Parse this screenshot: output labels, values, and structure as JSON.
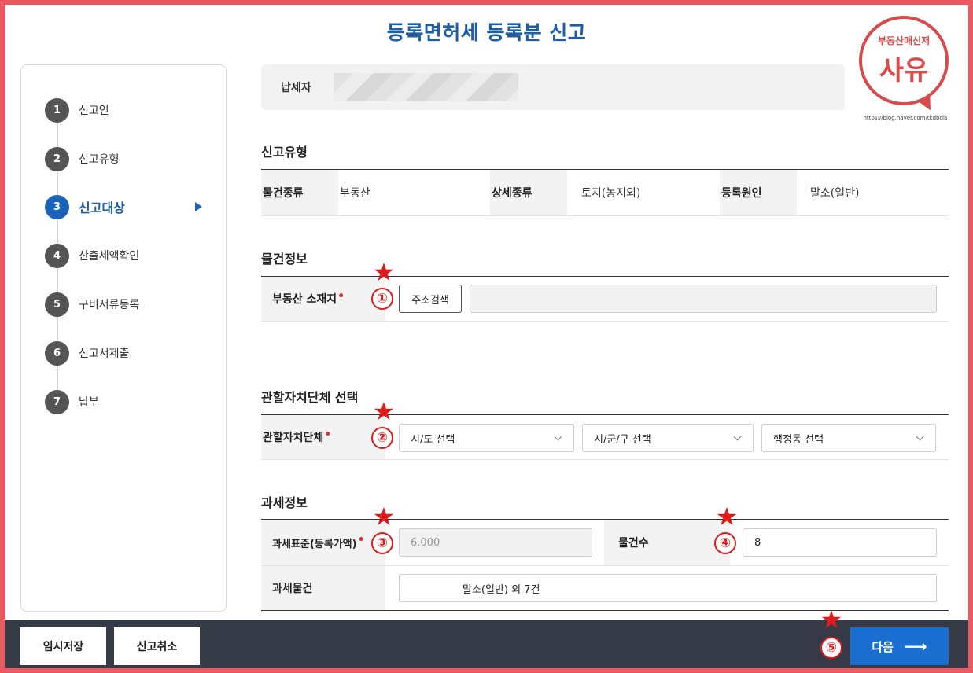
{
  "page": {
    "title": "등록면허세 등록분 신고"
  },
  "logo": {
    "top_text": "부동산매신저",
    "main_text": "사유",
    "url": "https://blog.naver.com/tkdbdls"
  },
  "sidebar": {
    "steps": [
      {
        "num": "1",
        "label": "신고인"
      },
      {
        "num": "2",
        "label": "신고유형"
      },
      {
        "num": "3",
        "label": "신고대상"
      },
      {
        "num": "4",
        "label": "산출세액확인"
      },
      {
        "num": "5",
        "label": "구비서류등록"
      },
      {
        "num": "6",
        "label": "신고서제출"
      },
      {
        "num": "7",
        "label": "납부"
      }
    ],
    "active_index": 2
  },
  "taxpayer": {
    "label": "납세자"
  },
  "report_type": {
    "title": "신고유형",
    "item_kind_label": "물건종류",
    "item_kind_value": "부동산",
    "detail_kind_label": "상세종류",
    "detail_kind_value": "토지(농지외)",
    "reg_cause_label": "등록원인",
    "reg_cause_value": "말소(일반)"
  },
  "property_info": {
    "title": "물건정보",
    "location_label": "부동산 소재지",
    "address_search_button": "주소검색",
    "address_value": ""
  },
  "jurisdiction": {
    "title": "관할자치단체 선택",
    "label": "관할자치단체",
    "sido_select": "시/도 선택",
    "sigungu_select": "시/군/구 선택",
    "dong_select": "행정동 선택"
  },
  "tax_info": {
    "title": "과세정보",
    "tax_base_label": "과세표준(등록가액)",
    "tax_base_value": "6,000",
    "item_count_label": "물건수",
    "item_count_value": "8",
    "tax_item_label": "과세물건",
    "tax_item_value": "말소(일반) 외 7건"
  },
  "annotations": {
    "marks": [
      "①",
      "②",
      "③",
      "④",
      "⑤"
    ],
    "star": "★",
    "color": "#e01b1b"
  },
  "footer": {
    "temp_save": "임시저장",
    "cancel": "신고취소",
    "next": "다음",
    "next_arrow": "⟶"
  },
  "colors": {
    "accent": "#1a5fa8",
    "button_blue": "#1a6ed0",
    "footer_bg": "#353a46",
    "frame": "#e85a5f"
  }
}
